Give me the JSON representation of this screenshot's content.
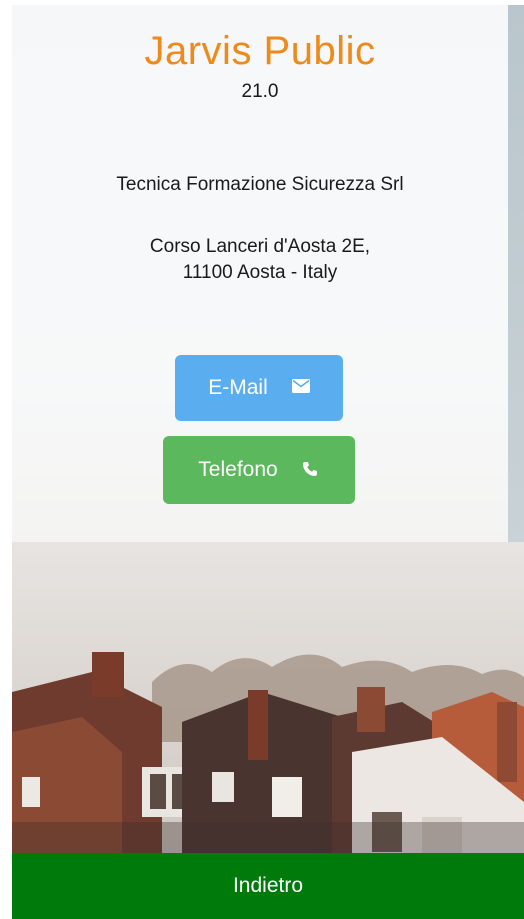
{
  "app": {
    "title": "Jarvis Public",
    "version": "21.0"
  },
  "info": {
    "company": "Tecnica Formazione Sicurezza Srl",
    "address_line1": "Corso Lanceri d'Aosta 2E,",
    "address_line2": "11100 Aosta - Italy"
  },
  "buttons": {
    "email_label": "E-Mail",
    "phone_label": "Telefono",
    "email_icon": "envelope-icon",
    "phone_icon": "phone-icon"
  },
  "footer": {
    "back_label": "Indietro"
  },
  "colors": {
    "title": "#ee8a1a",
    "email_button": "#5aaef0",
    "phone_button": "#5cb85c",
    "footer_bar": "#007a0a"
  }
}
